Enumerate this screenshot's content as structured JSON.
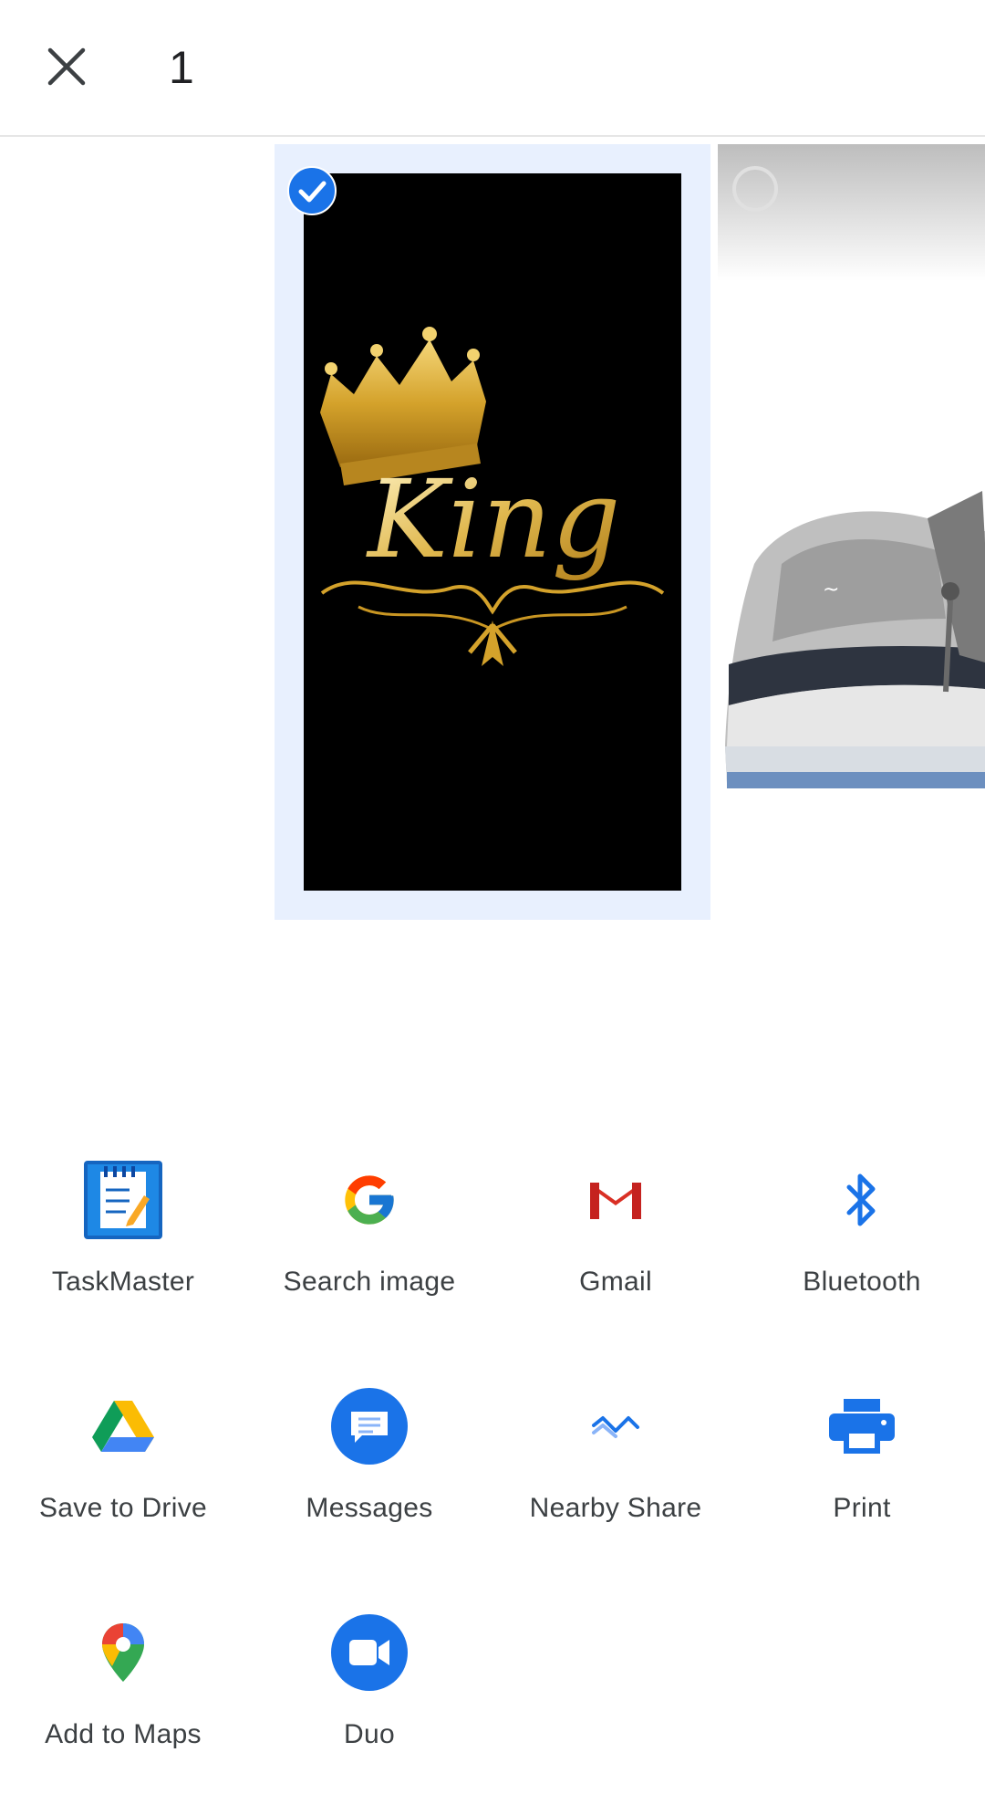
{
  "header": {
    "close_icon": "close-icon",
    "selected_count": "1"
  },
  "photos": [
    {
      "name": "King crown wallpaper",
      "selected": true
    },
    {
      "name": "Dior sneaker",
      "selected": false
    }
  ],
  "king_image_text": "King",
  "share_targets": [
    {
      "label": "TaskMaster",
      "icon": "taskmaster-icon"
    },
    {
      "label": "Search image",
      "icon": "google-icon"
    },
    {
      "label": "Gmail",
      "icon": "gmail-icon"
    },
    {
      "label": "Bluetooth",
      "icon": "bluetooth-icon"
    },
    {
      "label": "Save to Drive",
      "icon": "drive-icon"
    },
    {
      "label": "Messages",
      "icon": "messages-icon"
    },
    {
      "label": "Nearby Share",
      "icon": "nearby-share-icon"
    },
    {
      "label": "Print",
      "icon": "print-icon"
    },
    {
      "label": "Add to Maps",
      "icon": "maps-icon"
    },
    {
      "label": "Duo",
      "icon": "duo-icon"
    }
  ],
  "colors": {
    "accent_blue": "#1a73e8",
    "selection_bg": "#e8f0fe",
    "text": "#3c4043"
  }
}
